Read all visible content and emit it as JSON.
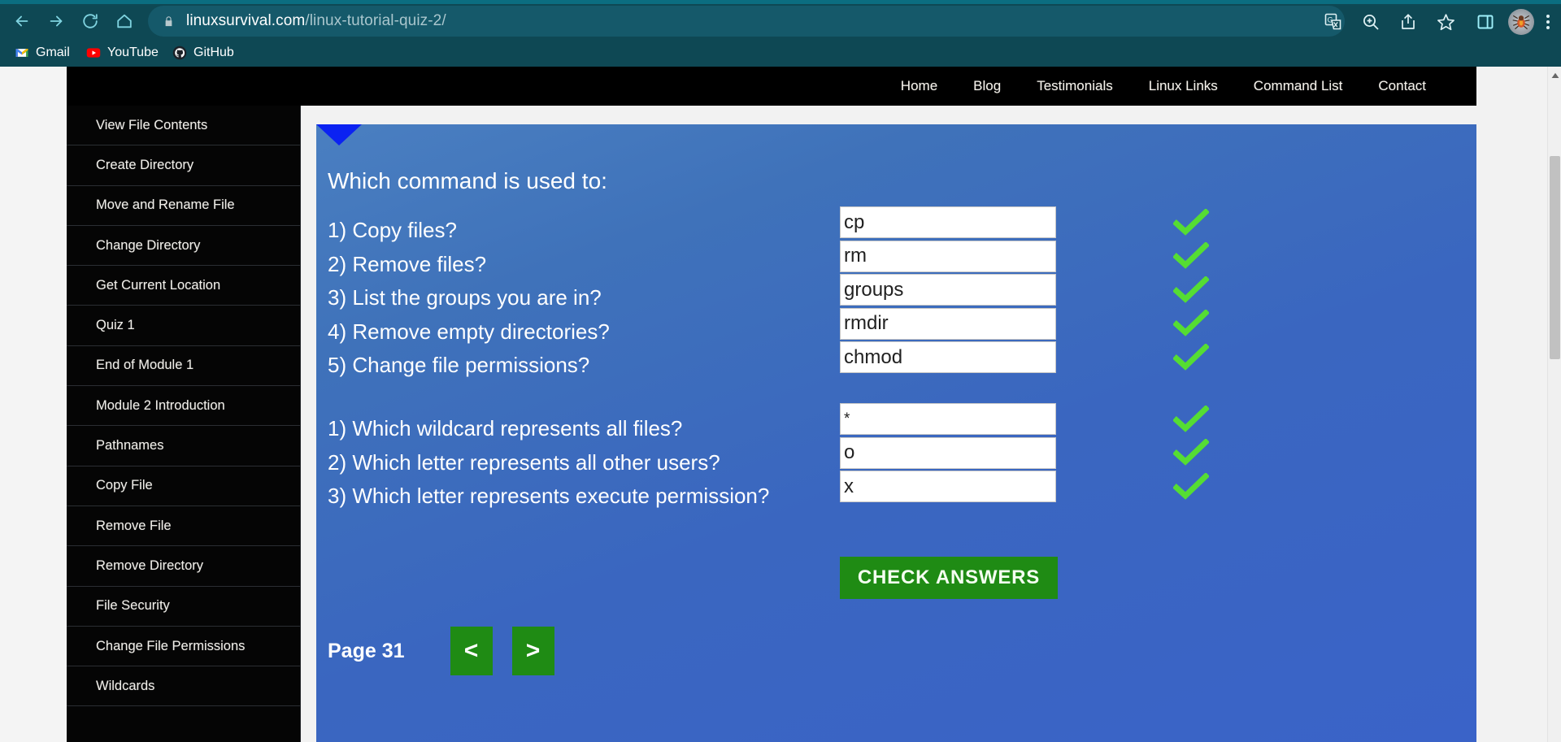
{
  "browser": {
    "nav": {
      "back_icon": "arrow-left-icon",
      "forward_icon": "arrow-right-icon",
      "reload_icon": "reload-icon",
      "home_icon": "home-icon"
    },
    "omnibox": {
      "lock_icon": "lock-icon",
      "url_domain": "linuxsurvival.com",
      "url_path": "/linux-tutorial-quiz-2/"
    },
    "toolbar_icons": [
      "translate-icon",
      "zoom-icon",
      "share-icon",
      "bookmark-star-icon",
      "side-panel-icon",
      "profile-avatar",
      "three-dot-menu-icon"
    ],
    "bookmarks": [
      {
        "label": "Gmail",
        "icon": "gmail-icon"
      },
      {
        "label": "YouTube",
        "icon": "youtube-icon"
      },
      {
        "label": "GitHub",
        "icon": "github-icon"
      }
    ]
  },
  "site": {
    "nav_links": [
      "Home",
      "Blog",
      "Testimonials",
      "Linux Links",
      "Command List",
      "Contact"
    ],
    "sidebar_items": [
      "View File Contents",
      "Create Directory",
      "Move and Rename File",
      "Change Directory",
      "Get Current Location",
      "Quiz 1",
      "End of Module 1",
      "Module 2 Introduction",
      "Pathnames",
      "Copy File",
      "Remove File",
      "Remove Directory",
      "File Security",
      "Change File Permissions",
      "Wildcards"
    ]
  },
  "quiz": {
    "heading": "Which command is used to:",
    "group1": {
      "questions": [
        "1) Copy files?",
        "2) Remove files?",
        "3) List the groups you are in?",
        "4) Remove empty directories?",
        "5) Change file permissions?"
      ],
      "answers": [
        "cp",
        "rm",
        "groups",
        "rmdir",
        "chmod"
      ],
      "results": [
        "correct",
        "correct",
        "correct",
        "correct",
        "correct"
      ]
    },
    "group2": {
      "questions": [
        "1) Which wildcard represents all files?",
        "2) Which letter represents all other users?",
        "3) Which letter represents execute permission?"
      ],
      "answers": [
        "*",
        "o",
        "x"
      ],
      "results": [
        "correct",
        "correct",
        "correct"
      ]
    },
    "check_button_label": "CHECK ANSWERS",
    "page_label": "Page 31",
    "prev_label": "<",
    "next_label": ">"
  },
  "colors": {
    "browser_chrome": "#0e4854",
    "omnibox": "#15596a",
    "site_header": "#000000",
    "sidebar": "#050505",
    "content_panel_blue": "#3a66c0",
    "button_green": "#1f8b14",
    "checkmark_green": "#55dd33",
    "pointer_blue": "#0b22f2"
  }
}
